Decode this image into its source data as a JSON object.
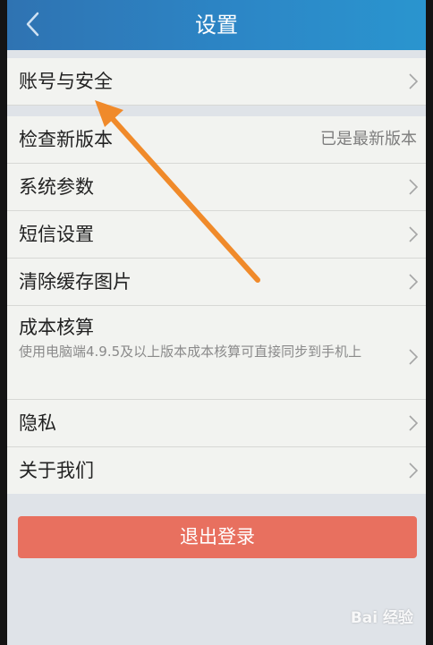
{
  "header": {
    "title": "设置"
  },
  "settings": {
    "account_security": "账号与安全",
    "check_update": "检查新版本",
    "check_update_status": "已是最新版本",
    "system_params": "系统参数",
    "sms_settings": "短信设置",
    "clear_cache": "清除缓存图片",
    "cost_accounting": "成本核算",
    "cost_accounting_desc": "使用电脑端4.9.5及以上版本成本核算可直接同步到手机上",
    "privacy": "隐私",
    "about_us": "关于我们"
  },
  "logout_label": "退出登录",
  "watermark": "Bai 经验",
  "colors": {
    "header_start": "#2f73b2",
    "header_end": "#2a95cf",
    "logout": "#e8705f",
    "annotation_arrow": "#f08a2a"
  }
}
